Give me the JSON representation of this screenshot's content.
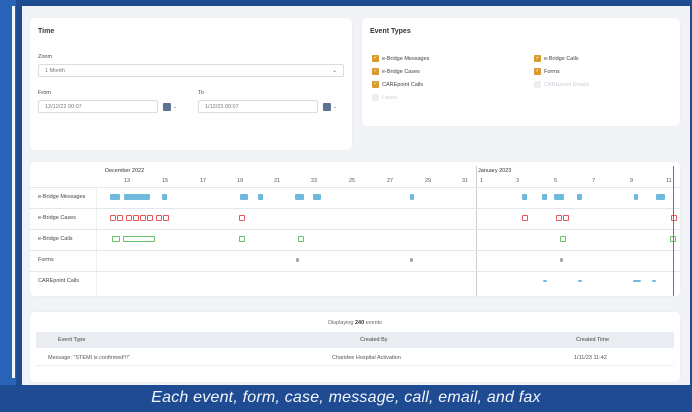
{
  "time": {
    "title": "Time",
    "zoom_label": "Zoom",
    "zoom_value": "1 Month",
    "from_label": "From",
    "from_value": "12/12/22 00:07",
    "to_label": "To",
    "to_value": "1/12/23 00:07"
  },
  "event_types": {
    "title": "Event Types",
    "items": [
      {
        "label": "e-Bridge Messages",
        "checked": true
      },
      {
        "label": "e-Bridge Calls",
        "checked": true
      },
      {
        "label": "e-Bridge Cases",
        "checked": true
      },
      {
        "label": "Forms",
        "checked": true
      },
      {
        "label": "CAREpoint Calls",
        "checked": true
      },
      {
        "label": "CAREpoint Emails",
        "checked": false
      },
      {
        "label": "Faxes",
        "checked": false
      }
    ]
  },
  "timeline": {
    "months": [
      "December 2022",
      "January 2023"
    ],
    "days": [
      "13",
      "15",
      "17",
      "19",
      "21",
      "23",
      "25",
      "27",
      "29",
      "31",
      "1",
      "3",
      "5",
      "7",
      "9",
      "11"
    ],
    "rows": [
      "e-Bridge Messages",
      "e-Bridge Cases",
      "e-Bridge Calls",
      "Forms",
      "CAREpoint Calls"
    ]
  },
  "table": {
    "displaying_prefix": "Displaying",
    "displaying_count": "240",
    "displaying_suffix": "events",
    "columns": [
      "Event Type",
      "Created By",
      "Created Time"
    ],
    "rows": [
      [
        "Message: \"STEMI is confirmed!!!\"",
        "Charidee Hospital Activation",
        "1/11/23 11:42"
      ]
    ]
  },
  "caption": "Each event, form, case, message, call, email, and fax",
  "colors": {
    "background": "#1f4b93",
    "checkbox": "#d89a2a",
    "message_marker": "#6fb9dc",
    "case_marker": "#e35a5a",
    "call_marker": "#69c26a",
    "now_line": "#e0443a"
  }
}
